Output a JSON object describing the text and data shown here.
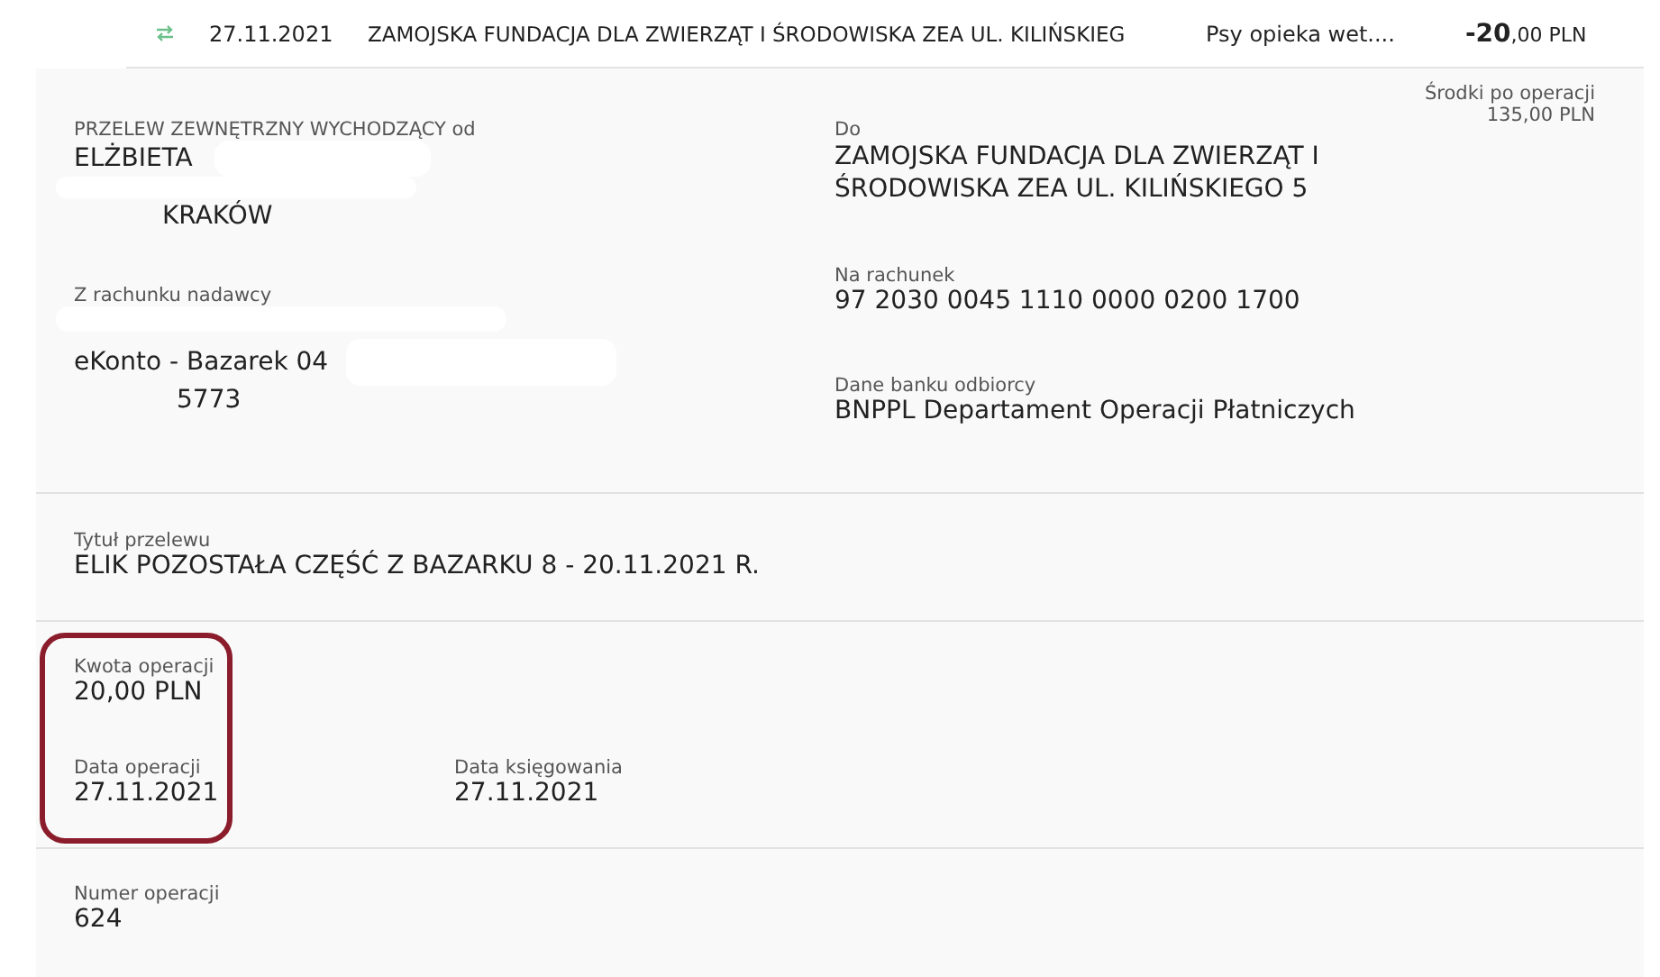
{
  "transaction": {
    "date": "27.11.2021",
    "counterparty": "ZAMOJSKA FUNDACJA DLA ZWIERZĄT I ŚRODOWISKA ZEA UL. KILIŃSKIEG",
    "category": "Psy opieka wet....",
    "amount_main": "-20",
    "amount_rest": ",00 PLN"
  },
  "details": {
    "sender_label": "PRZELEW ZEWNĘTRZNY WYCHODZĄCY od",
    "sender_name": "ELŻBIETA",
    "sender_city": "KRAKÓW",
    "account_label": "Z rachunku nadawcy",
    "account_name": "eKonto - Bazarek 04",
    "account_number": "5773",
    "recipient_label": "Do",
    "recipient_name": "ZAMOJSKA FUNDACJA DLA ZWIERZĄT I ŚRODOWISKA ZEA UL. KILIŃSKIEGO 5",
    "recipient_account_label": "Na rachunek",
    "recipient_account": "97 2030 0045 1110 0000 0200 1700",
    "bank_label": "Dane banku odbiorcy",
    "bank_name": "BNPPL Departament Operacji Płatniczych",
    "balance_label": "Środki po operacji",
    "balance_value": "135,00 PLN"
  },
  "title": {
    "label": "Tytuł przelewu",
    "value": "ELIK POZOSTAŁA CZĘŚĆ Z BAZARKU 8 - 20.11.2021 R."
  },
  "amounts": {
    "highlighted": true,
    "amount_label": "Kwota operacji",
    "amount_value": "20,00 PLN",
    "date_label": "Data operacji",
    "date_value": "27.11.2021",
    "booking_label": "Data księgowania",
    "booking_value": "27.11.2021"
  },
  "operation": {
    "label": "Numer operacji",
    "value": "624"
  }
}
